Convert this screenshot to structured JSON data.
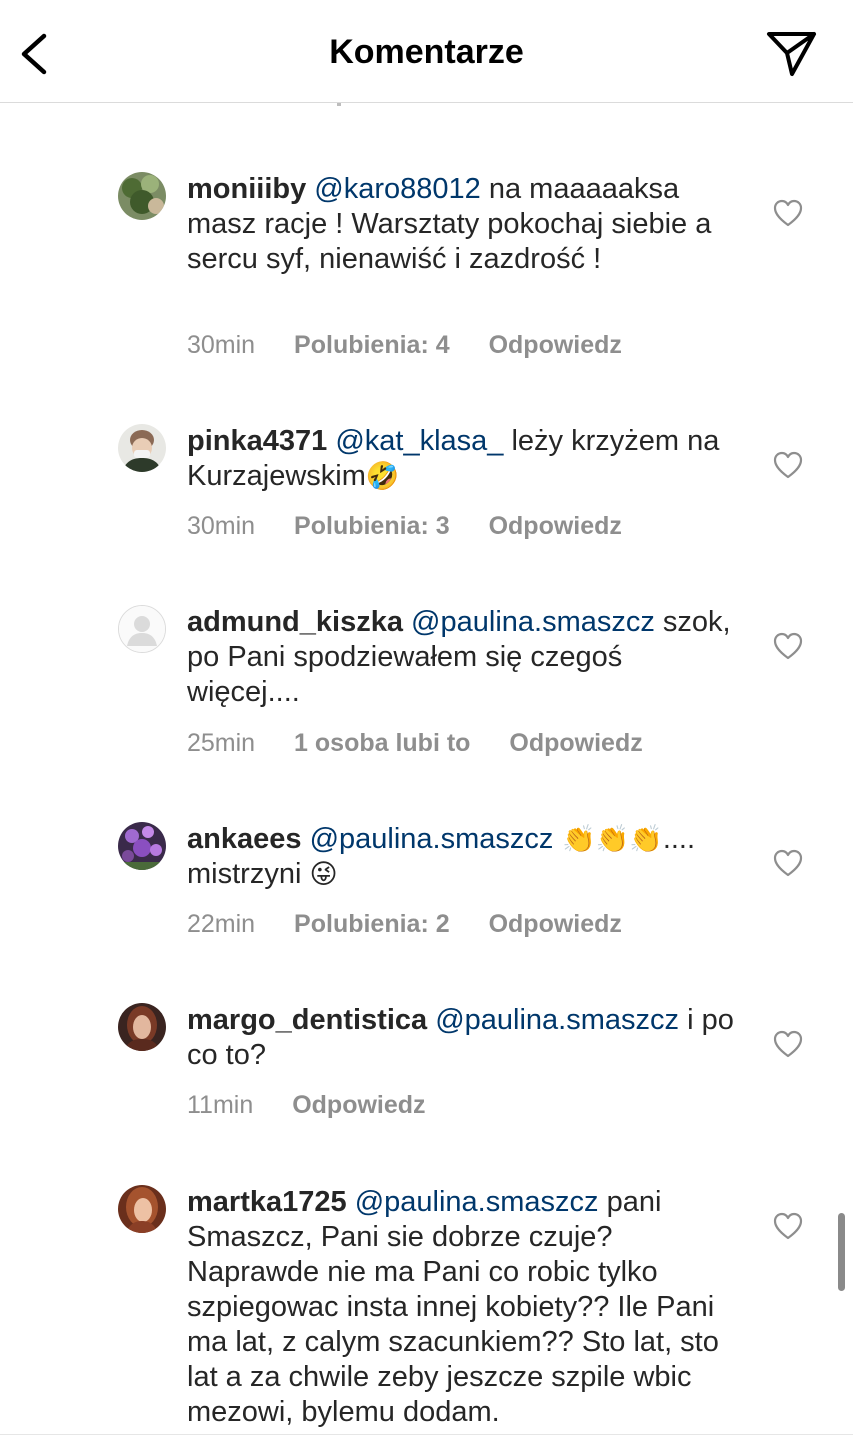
{
  "header": {
    "title": "Komentarze"
  },
  "comments": [
    {
      "username": "moniiiby",
      "mention": "@karo88012",
      "text": " na maaaaaksa masz racje ! Warsztaty pokochaj siebie a sercu syf, nienawiść i zazdrość !",
      "time": "30min",
      "likes": "Polubienia: 4",
      "reply": "Odpowiedz"
    },
    {
      "username": "pinka4371",
      "mention": "@kat_klasa_",
      "text": " leży krzyżem na Kurzajewskim",
      "emoji": "🤣",
      "time": "30min",
      "likes": "Polubienia: 3",
      "reply": "Odpowiedz"
    },
    {
      "username": "admund_kiszka",
      "mention": "@paulina.smaszcz",
      "text": " szok, po Pani spodziewałem się czegoś więcej....",
      "time": "25min",
      "likes": "1 osoba lubi to",
      "reply": "Odpowiedz"
    },
    {
      "username": "ankaees",
      "mention": "@paulina.smaszcz",
      "emoji1": " 👏👏👏",
      "text": ".... mistrzyni ",
      "emoji2": "😜",
      "time": "22min",
      "likes": "Polubienia: 2",
      "reply": "Odpowiedz"
    },
    {
      "username": "margo_dentistica",
      "mention": "@paulina.smaszcz",
      "text": " i po co to?",
      "time": "11min",
      "reply": "Odpowiedz"
    },
    {
      "username": "martka1725",
      "mention": "@paulina.smaszcz",
      "text": " pani Smaszcz, Pani sie dobrze czuje? Naprawde nie ma Pani co robic tylko szpiegowac insta innej kobiety?? Ile Pani ma lat, z calym szacunkiem?? Sto lat, sto lat a za chwile zeby jeszcze szpile wbic mezowi, bylemu dodam."
    }
  ],
  "icons": {
    "back": "chevron-left-icon",
    "send": "paper-plane-icon",
    "like": "heart-outline-icon"
  },
  "colors": {
    "mention": "#00376b",
    "meta": "#8e8e8e",
    "text": "#262626"
  }
}
